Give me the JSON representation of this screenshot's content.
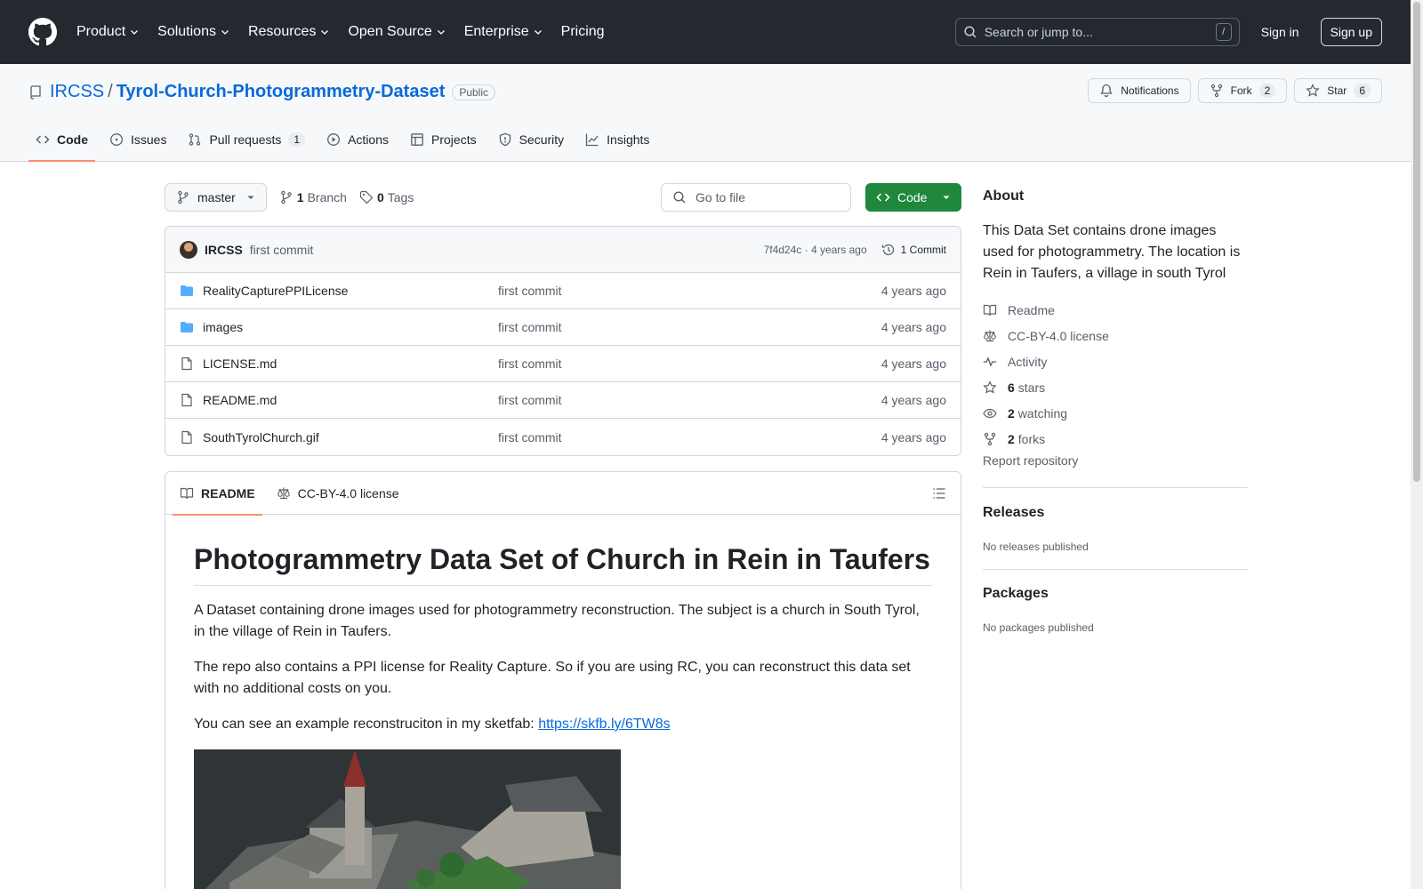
{
  "colors": {
    "header_bg": "#24292f",
    "link": "#0969da",
    "accent_green": "#1f883d",
    "tab_underline": "#fd8c73",
    "muted": "#57606a"
  },
  "header": {
    "nav": [
      "Product",
      "Solutions",
      "Resources",
      "Open Source",
      "Enterprise",
      "Pricing"
    ],
    "search_placeholder": "Search or jump to...",
    "search_key": "/",
    "sign_in": "Sign in",
    "sign_up": "Sign up"
  },
  "repo": {
    "owner": "IRCSS",
    "separator": "/",
    "name": "Tyrol-Church-Photogrammetry-Dataset",
    "visibility": "Public",
    "notifications_label": "Notifications",
    "fork_label": "Fork",
    "fork_count": "2",
    "star_label": "Star",
    "star_count": "6"
  },
  "tabs": [
    {
      "label": "Code",
      "icon": "code-icon"
    },
    {
      "label": "Issues",
      "icon": "issue-icon"
    },
    {
      "label": "Pull requests",
      "icon": "pull-request-icon",
      "count": "1"
    },
    {
      "label": "Actions",
      "icon": "play-icon"
    },
    {
      "label": "Projects",
      "icon": "table-icon"
    },
    {
      "label": "Security",
      "icon": "shield-icon"
    },
    {
      "label": "Insights",
      "icon": "graph-icon"
    }
  ],
  "toolbar": {
    "branch": "master",
    "branch_count": "1",
    "branch_label": "Branch",
    "tag_count": "0",
    "tag_label": "Tags",
    "goto_placeholder": "Go to file",
    "code_button": "Code"
  },
  "latest_commit": {
    "author": "IRCSS",
    "message": "first commit",
    "meta": "7f4d24c · 4 years ago",
    "count_label": "1 Commit"
  },
  "files": [
    {
      "name": "RealityCapturePPILicense",
      "type": "folder",
      "commit": "first commit",
      "age": "4 years ago"
    },
    {
      "name": "images",
      "type": "folder",
      "commit": "first commit",
      "age": "4 years ago"
    },
    {
      "name": "LICENSE.md",
      "type": "file",
      "commit": "first commit",
      "age": "4 years ago"
    },
    {
      "name": "README.md",
      "type": "file",
      "commit": "first commit",
      "age": "4 years ago"
    },
    {
      "name": "SouthTyrolChurch.gif",
      "type": "file",
      "commit": "first commit",
      "age": "4 years ago"
    }
  ],
  "readme": {
    "tab_readme": "README",
    "tab_license": "CC-BY-4.0 license",
    "title": "Photogrammetry Data Set of Church in Rein in Taufers",
    "p1": "A Dataset containing drone images used for photogrammetry reconstruction. The subject is a church in South Tyrol, in the village of Rein in Taufers.",
    "p2": "The repo also contains a PPI license for Reality Capture. So if you are using RC, you can reconstruct this data set with no additional costs on you.",
    "p3": "You can see an example reconstruciton in my sketfab: ",
    "link": "https://skfb.ly/6TW8s"
  },
  "about": {
    "heading": "About",
    "description": "This Data Set contains drone images used for photogrammetry. The location is Rein in Taufers, a village in south Tyrol",
    "links": [
      {
        "icon": "book-icon",
        "label": "Readme"
      },
      {
        "icon": "law-icon",
        "label": "CC-BY-4.0 license"
      },
      {
        "icon": "pulse-icon",
        "label": "Activity"
      },
      {
        "icon": "star-icon",
        "count": "6",
        "label": "stars"
      },
      {
        "icon": "eye-icon",
        "count": "2",
        "label": "watching"
      },
      {
        "icon": "fork-icon",
        "count": "2",
        "label": "forks"
      }
    ],
    "report": "Report repository",
    "releases_heading": "Releases",
    "releases_text": "No releases published",
    "packages_heading": "Packages",
    "packages_text": "No packages published"
  }
}
